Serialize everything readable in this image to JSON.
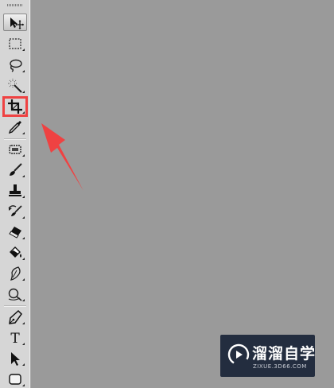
{
  "toolbar": {
    "tools": [
      {
        "id": "move",
        "icon": "move-tool-icon",
        "active": true
      },
      {
        "id": "marquee",
        "icon": "rectangular-marquee-icon"
      },
      {
        "id": "lasso",
        "icon": "lasso-icon"
      },
      {
        "id": "magic-wand",
        "icon": "magic-wand-icon"
      },
      {
        "id": "crop",
        "icon": "crop-icon",
        "highlighted": true
      },
      {
        "id": "eyedropper",
        "icon": "eyedropper-icon"
      },
      {
        "id": "healing",
        "icon": "spot-healing-icon"
      },
      {
        "id": "brush",
        "icon": "brush-icon"
      },
      {
        "id": "stamp",
        "icon": "clone-stamp-icon"
      },
      {
        "id": "history-brush",
        "icon": "history-brush-icon"
      },
      {
        "id": "eraser",
        "icon": "eraser-icon"
      },
      {
        "id": "paint-bucket",
        "icon": "paint-bucket-icon"
      },
      {
        "id": "blur",
        "icon": "blur-icon"
      },
      {
        "id": "dodge",
        "icon": "dodge-icon"
      },
      {
        "id": "pen",
        "icon": "pen-icon"
      },
      {
        "id": "type",
        "icon": "type-icon",
        "label": "T"
      },
      {
        "id": "path-selection",
        "icon": "path-selection-icon"
      },
      {
        "id": "shape",
        "icon": "rounded-rectangle-icon"
      }
    ]
  },
  "annotation": {
    "highlight_color": "#ef4242",
    "arrow_color": "#ef4242"
  },
  "watermark": {
    "title": "溜溜自学",
    "url": "ZIXUE.3D66.COM",
    "background": "#232d3f"
  },
  "canvas": {
    "background": "#9a9a9a"
  }
}
